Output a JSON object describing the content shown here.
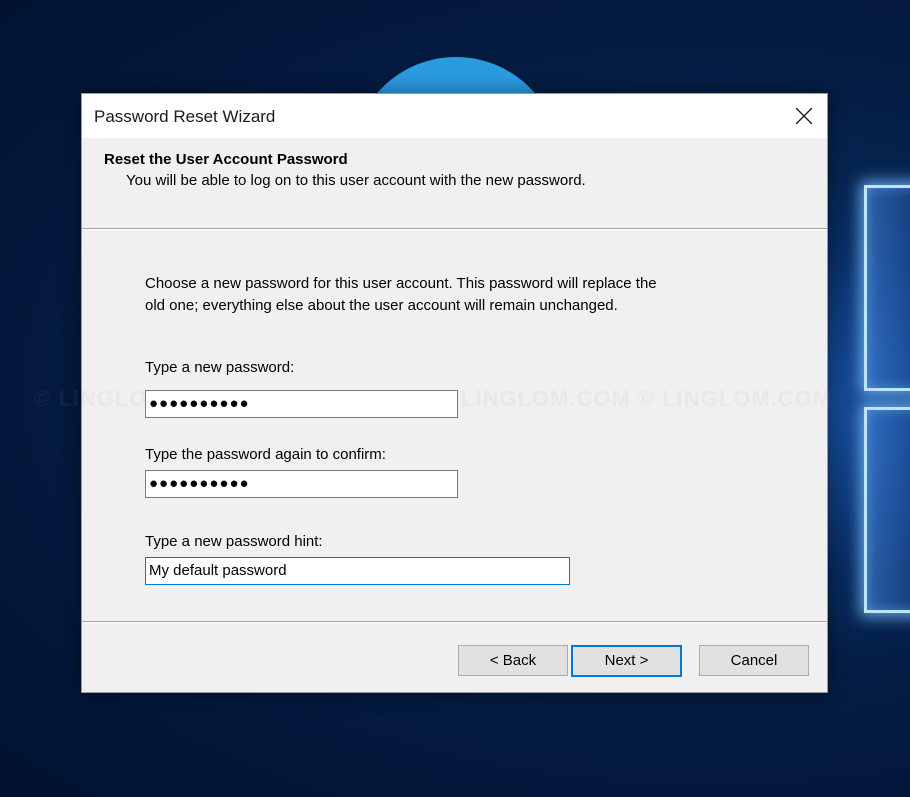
{
  "dialog": {
    "title": "Password Reset Wizard",
    "header_title": "Reset the User Account Password",
    "header_subtitle": "You will be able to log on to this user account with the new password.",
    "intro_line1": "Choose a new password for this user account. This password will replace the",
    "intro_line2": "old one; everything else about the user account will remain unchanged.",
    "watermark": "© LINGLOM.COM      © LINGLOM.COM      © LINGLOM.COM      © LINGLOM.COM"
  },
  "fields": {
    "new_password": {
      "label": "Type a new password:",
      "value": "●●●●●●●●●●"
    },
    "confirm_password": {
      "label": "Type the password again to confirm:",
      "value": "●●●●●●●●●●"
    },
    "hint": {
      "label": "Type a new password hint:",
      "value": "My default password"
    }
  },
  "buttons": {
    "back": "< Back",
    "next": "Next >",
    "cancel": "Cancel"
  },
  "colors": {
    "focus_accent": "#0078d7",
    "dialog_bg": "#f0f0f0",
    "desktop_accent": "#2b9be0"
  },
  "icons": {
    "close": "close-icon"
  }
}
